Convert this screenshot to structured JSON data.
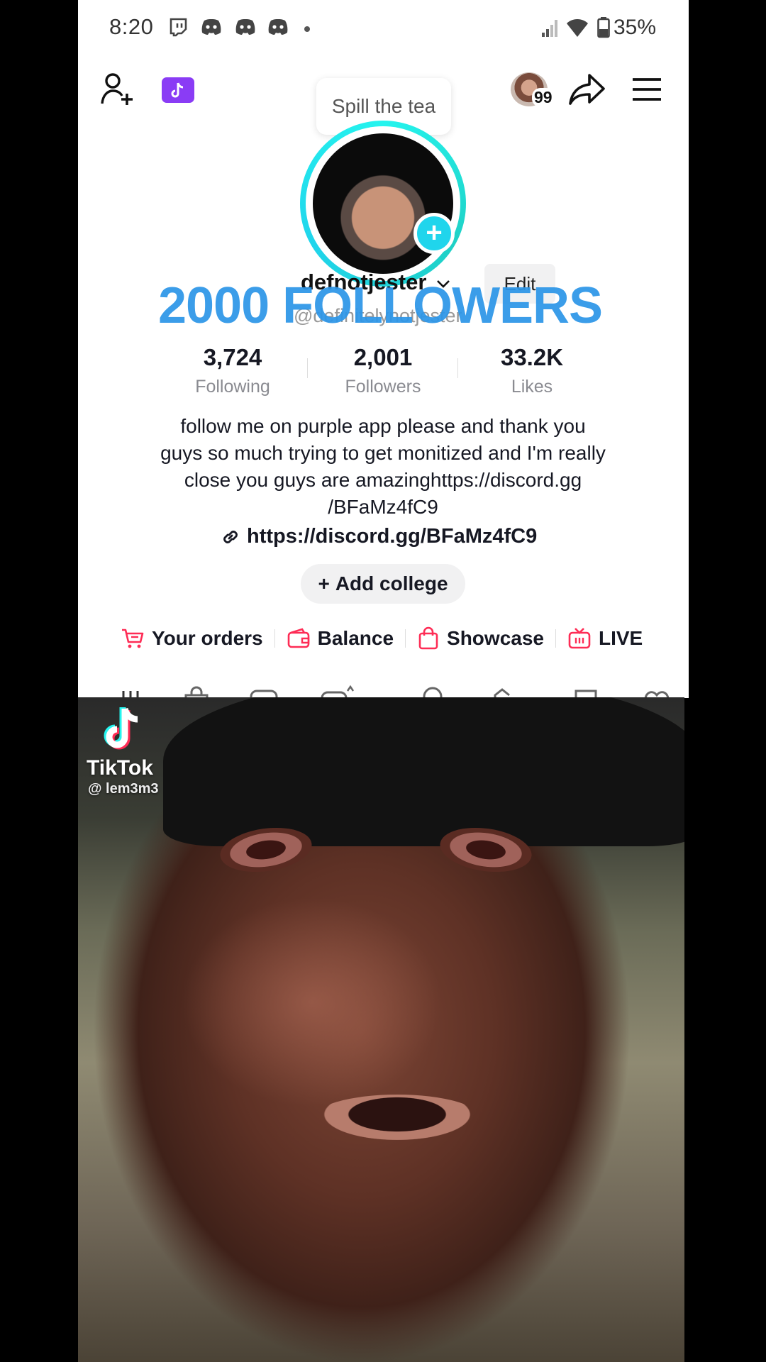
{
  "status_bar": {
    "time": "8:20",
    "battery": "35%",
    "notification_icons": [
      "twitch-icon",
      "discord-icon",
      "discord-icon",
      "discord-icon",
      "dot-icon"
    ]
  },
  "top_bar": {
    "add_friend_icon": "add-user-icon",
    "tiktok_badge_icon": "tiktok-icon",
    "spill_bubble": "Spill the tea",
    "visitor_count": "99",
    "share_icon": "share-icon",
    "menu_icon": "hamburger-icon"
  },
  "profile": {
    "username": "defnotjester",
    "handle": "@definitelynotjester",
    "edit_label": "Edit",
    "overlay_caption": "2000 FOLLOWERS",
    "stats": [
      {
        "value": "3,724",
        "label": "Following"
      },
      {
        "value": "2,001",
        "label": "Followers"
      },
      {
        "value": "33.2K",
        "label": "Likes"
      }
    ],
    "bio_lines": [
      "follow me on purple app please and thank you",
      "guys so much trying to get monitized and I'm really",
      "close you guys are amazinghttps://discord.gg",
      "/BFaMz4fC9"
    ],
    "link": "https://discord.gg/BFaMz4fC9",
    "add_college": "Add college"
  },
  "shortcuts": [
    {
      "label": "Your orders",
      "icon": "cart-icon"
    },
    {
      "label": "Balance",
      "icon": "wallet-icon"
    },
    {
      "label": "Showcase",
      "icon": "shopping-bag-icon"
    },
    {
      "label": "LIVE",
      "icon": "tv-icon"
    }
  ],
  "video_overlay": {
    "brand": "TikTok",
    "user": "@ lem3m3"
  },
  "colors": {
    "accent_pink": "#fe2c55",
    "caption_blue": "#2d96e8",
    "ring_cyan": "#20d5ec",
    "badge_purple": "#8a3cf5"
  }
}
